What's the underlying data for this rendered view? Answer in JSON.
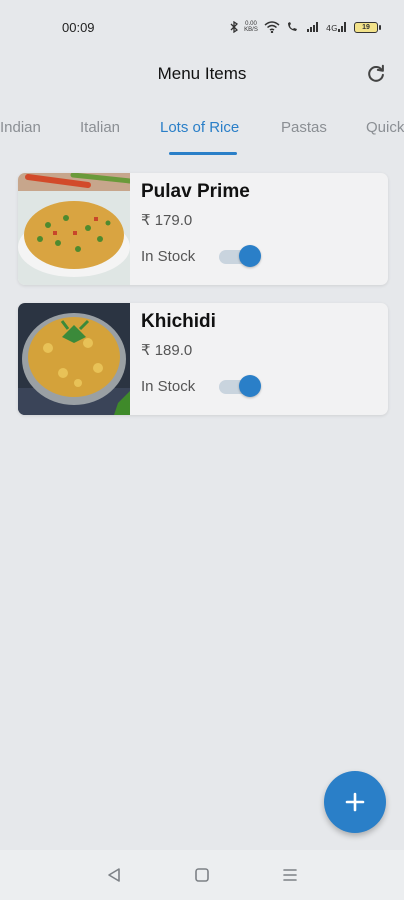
{
  "status_bar": {
    "time": "00:09",
    "speed": "0.00 KB/S",
    "battery": "19"
  },
  "header": {
    "title": "Menu Items",
    "refresh_icon": "refresh-icon"
  },
  "tabs": [
    {
      "label": "Indian",
      "active": false
    },
    {
      "label": "Italian",
      "active": false
    },
    {
      "label": "Lots of Rice",
      "active": true
    },
    {
      "label": "Pastas",
      "active": false
    },
    {
      "label": "Quick",
      "active": false
    }
  ],
  "items": [
    {
      "name": "Pulav Prime",
      "price": "₹ 179.0",
      "stock_label": "In Stock",
      "in_stock": true
    },
    {
      "name": "Khichidi",
      "price": "₹ 189.0",
      "stock_label": "In Stock",
      "in_stock": true
    }
  ],
  "fab": {
    "icon": "plus-icon"
  },
  "nav": {
    "back_icon": "back-triangle-icon",
    "home_icon": "home-square-icon",
    "menu_icon": "menu-lines-icon"
  },
  "colors": {
    "accent": "#2a7fc8",
    "background": "#e6e8eb",
    "card": "#f2f2f3"
  }
}
